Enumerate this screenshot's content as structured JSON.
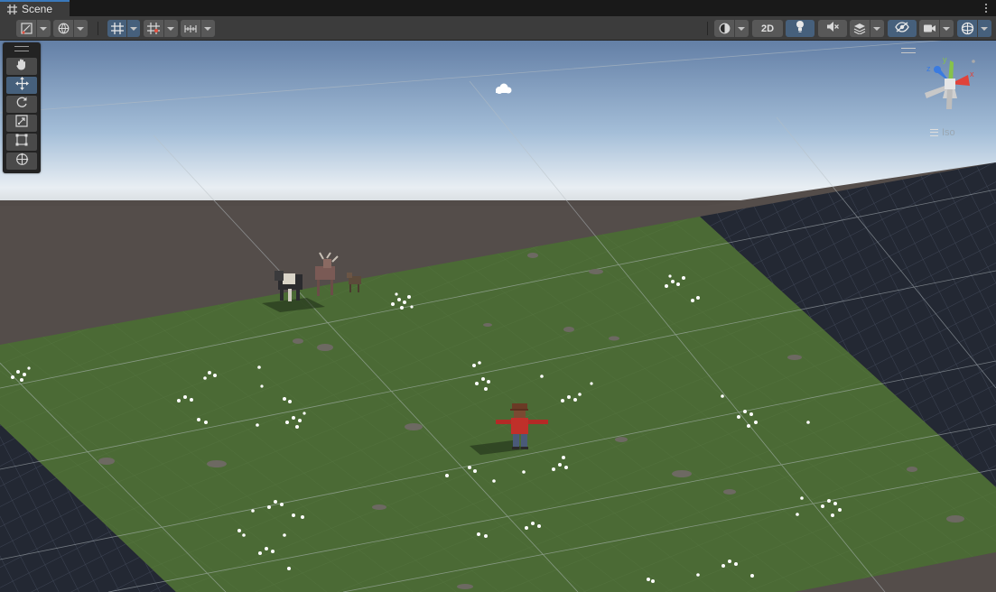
{
  "tab": {
    "label": "Scene"
  },
  "toolbar": {
    "view_mode_label": "2D"
  },
  "scene_view": {
    "projection_label": "Iso"
  },
  "gizmo": {
    "x_label": "x",
    "y_label": "y",
    "z_label": "z"
  },
  "icons": {
    "tab": "grid-hash-icon",
    "menu": "more-vertical-icon",
    "tools": [
      "hand-icon",
      "move-icon",
      "rotate-icon",
      "scale-icon",
      "rect-transform-icon",
      "transform-icon"
    ]
  },
  "colors": {
    "accent": "#3a79bb",
    "active_button": "#46607c",
    "grass": "#4b6a35",
    "ground_plane": "#524b48",
    "gizmo_x": "#e0433a",
    "gizmo_y": "#86c24a",
    "gizmo_z": "#3a7be0"
  }
}
